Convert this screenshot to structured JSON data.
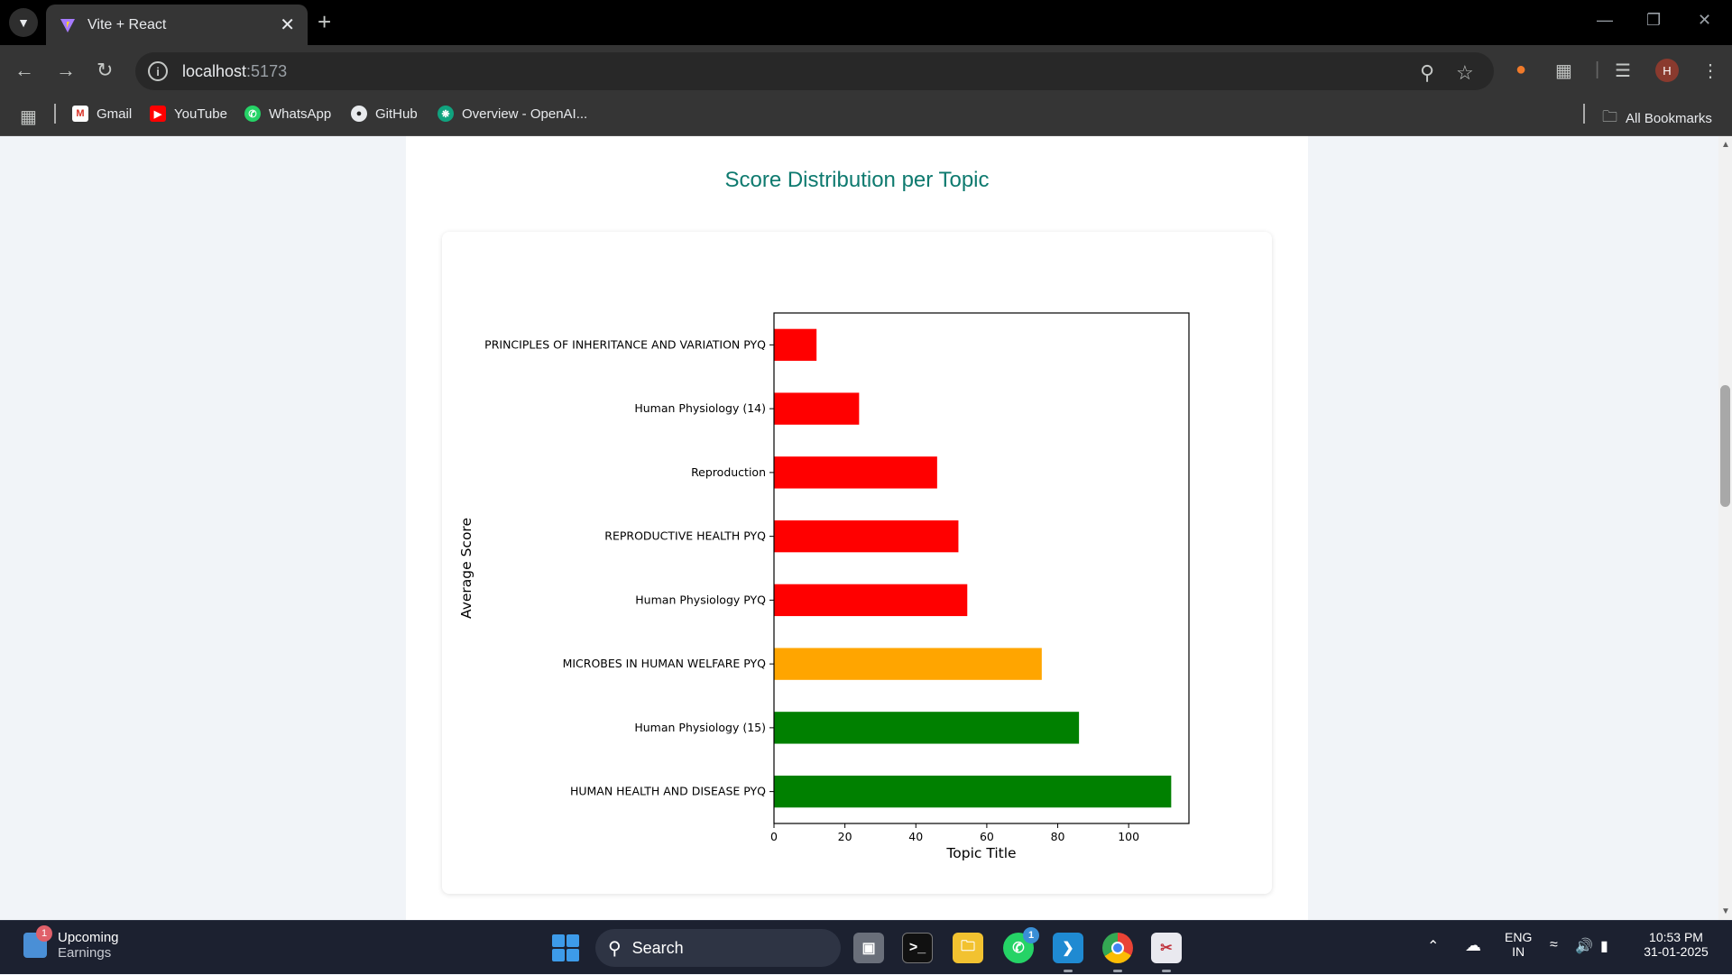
{
  "browser": {
    "tab_title": "Vite + React",
    "url_main": "localhost",
    "url_port": ":5173",
    "bookmarks": [
      "Gmail",
      "YouTube",
      "WhatsApp",
      "GitHub",
      "Overview - OpenAI..."
    ],
    "all_bookmarks": "All Bookmarks"
  },
  "page": {
    "heading": "Score Distribution per Topic"
  },
  "chart_data": {
    "type": "bar",
    "orientation": "horizontal",
    "categories": [
      "HUMAN HEALTH AND DISEASE PYQ",
      "Human Physiology (15)",
      "MICROBES IN HUMAN WELFARE  PYQ",
      "Human Physiology PYQ",
      "REPRODUCTIVE HEALTH PYQ",
      "Reproduction",
      "Human Physiology (14)",
      "PRINCIPLES OF INHERITANCE AND VARIATION PYQ"
    ],
    "values": [
      112,
      86,
      75.5,
      54.5,
      52,
      46,
      24,
      12
    ],
    "colors": [
      "#008000",
      "#008000",
      "#ffa500",
      "#ff0000",
      "#ff0000",
      "#ff0000",
      "#ff0000",
      "#ff0000"
    ],
    "xlabel": "Topic Title",
    "ylabel": "Average Score",
    "xlim": [
      0,
      117
    ],
    "xticks": [
      0,
      20,
      40,
      60,
      80,
      100
    ],
    "grid": false
  },
  "taskbar": {
    "widget_title": "Upcoming",
    "widget_sub": "Earnings",
    "widget_badge": "1",
    "search_label": "Search",
    "whatsapp_badge": "1",
    "lang": "ENG",
    "region": "IN",
    "time": "10:53 PM",
    "date": "31-01-2025"
  }
}
